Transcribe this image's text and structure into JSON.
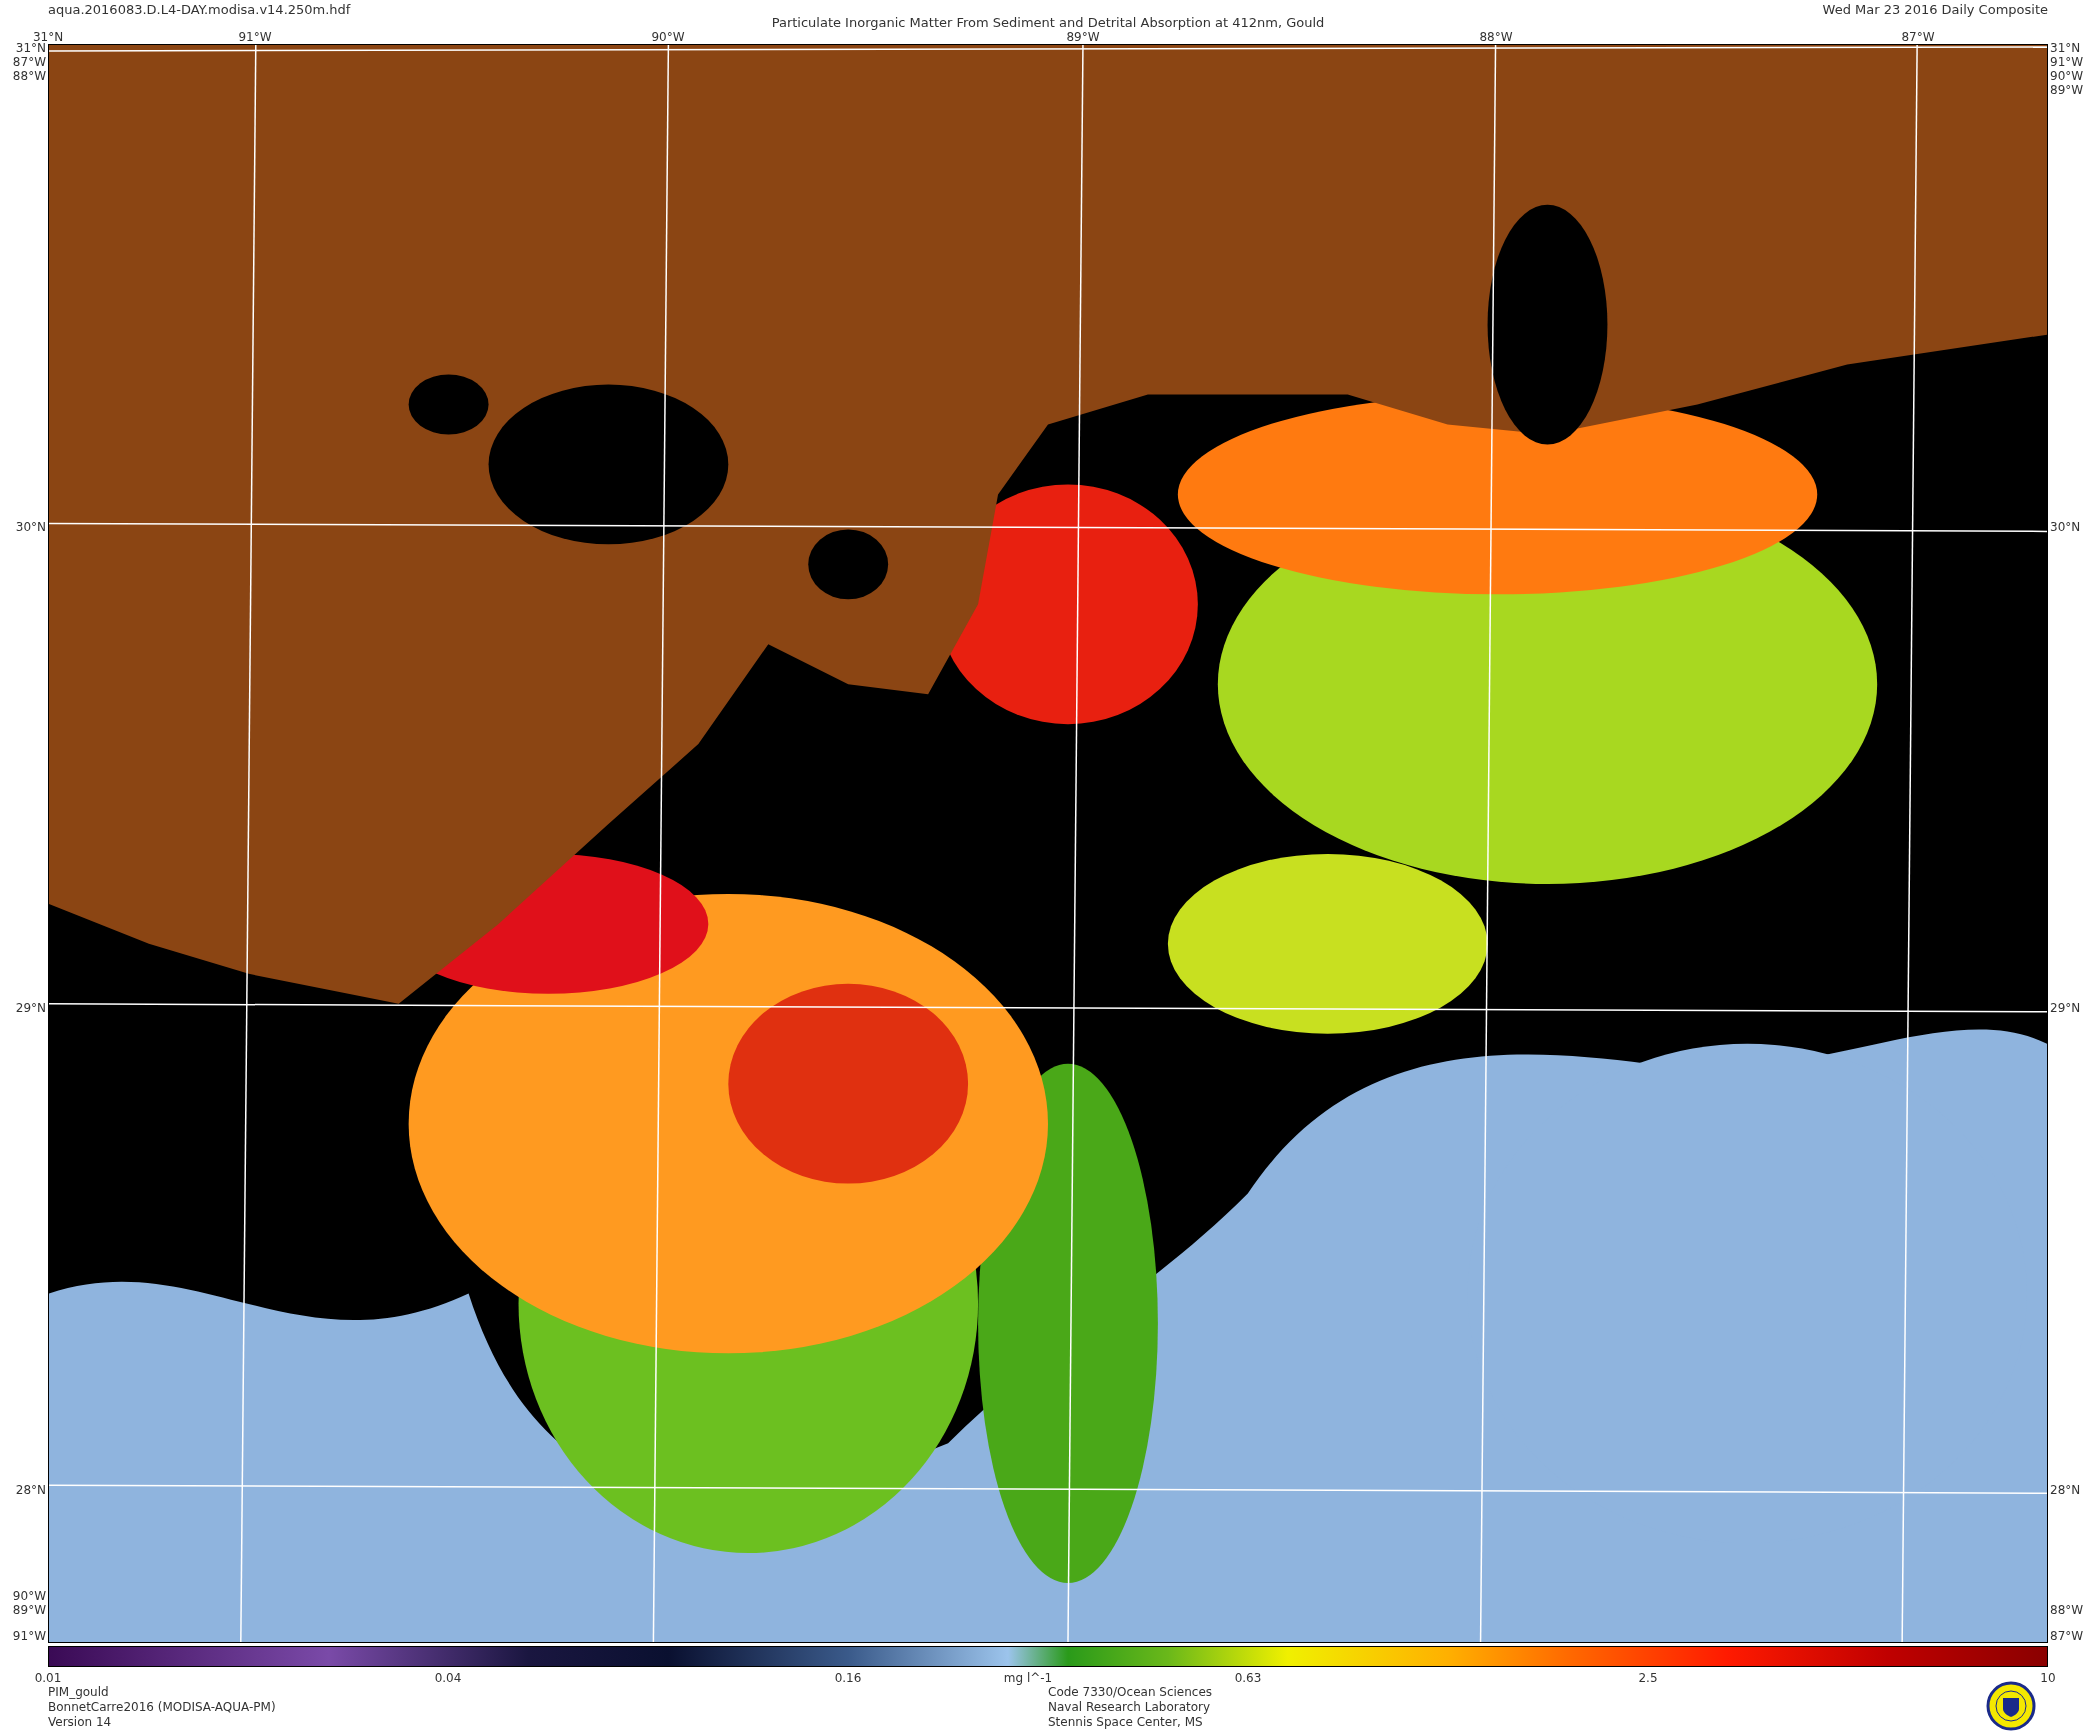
{
  "header": {
    "filename": "aqua.2016083.D.L4-DAY.modisa.v14.250m.hdf",
    "title": "Particulate Inorganic Matter From Sediment and Detrital Absorption at 412nm, Gould",
    "date": "Wed Mar 23 2016 Daily Composite"
  },
  "map": {
    "top_labels": [
      "31°N",
      "91°W",
      "90°W",
      "89°W",
      "88°W",
      "87°W"
    ],
    "left_labels": [
      "31°N",
      "87°W",
      "88°W",
      "30°N",
      "29°N",
      "28°N",
      "90°W",
      "89°W",
      "91°W"
    ],
    "right_labels": [
      "31°N",
      "91°W",
      "90°W",
      "89°W",
      "30°N",
      "29°N",
      "28°N",
      "88°W",
      "87°W"
    ]
  },
  "colorbar": {
    "ticks": [
      "0.01",
      "0.04",
      "0.16",
      "0.63",
      "2.5",
      "10"
    ],
    "unit": "mg l^-1"
  },
  "footer_left": [
    "PIM_gould",
    "BonnetCarre2016 (MODISA-AQUA-PM)",
    "Version 14"
  ],
  "footer_center": [
    "Code 7330/Ocean Sciences",
    "Naval Research Laboratory",
    "Stennis Space Center, MS"
  ]
}
